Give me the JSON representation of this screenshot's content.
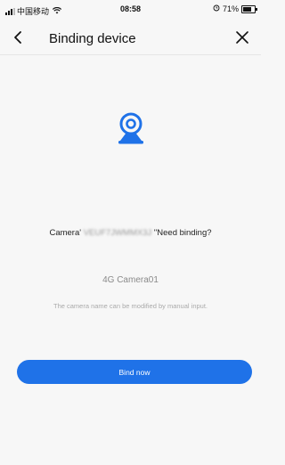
{
  "status_bar": {
    "carrier": "中国移动",
    "time": "08:58",
    "battery": "71%"
  },
  "header": {
    "title": "Binding device"
  },
  "icons": {
    "back": "chevron-left-icon",
    "close": "close-icon",
    "camera": "camera-device-icon",
    "wifi": "wifi-icon",
    "battery": "battery-icon",
    "alarm": "alarm-icon"
  },
  "colors": {
    "accent": "#1f72e8",
    "background": "#f7f7f7"
  },
  "prompt": {
    "prefix": "Camera'",
    "device_id": "VEUF7JWMMX3J",
    "suffix": "\"Need binding?"
  },
  "camera_name": {
    "value": "4G Camera01"
  },
  "hint": "The camera name can be modified by manual input.",
  "bind_button": {
    "label": "Bind now"
  }
}
